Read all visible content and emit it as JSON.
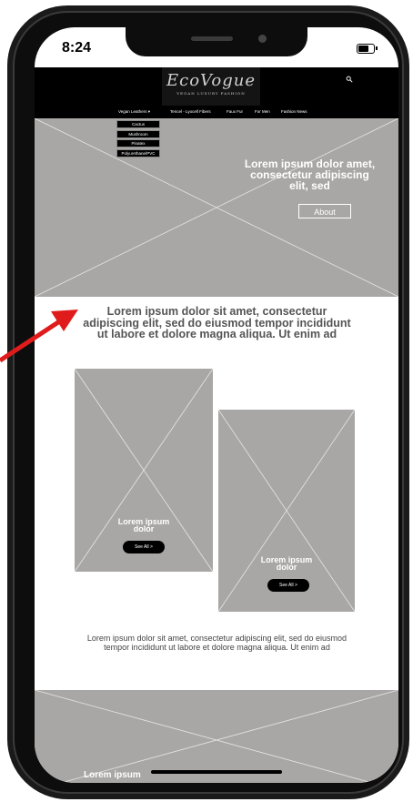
{
  "status_bar": {
    "time": "8:24"
  },
  "header": {
    "logo": "EcoVogue",
    "logo_tagline": "VEGAN LUXURY FASHION",
    "nav": [
      "Vegan Leathers ▾",
      "Tencel - Lyocell Fibers",
      "Faux Fur",
      "For Men",
      "Fashion News"
    ],
    "dropdown": [
      "Cactus",
      "Mushroom",
      "Pinatex",
      "Polyurethane/PVC"
    ]
  },
  "hero": {
    "title": "Lorem ipsum dolor amet, consectetur adipiscing elit, sed",
    "button": "About"
  },
  "section": {
    "heading": "Lorem ipsum dolor sit amet, consectetur adipiscing elit, sed do eiusmod tempor incididunt ut labore et dolore magna aliqua. Ut enim ad",
    "cards": [
      {
        "title": "Lorem ipsum dolor",
        "button": "See All >"
      },
      {
        "title": "Lorem ipsum dolor",
        "button": "See All >"
      }
    ],
    "body": "Lorem ipsum dolor sit amet, consectetur adipiscing elit, sed do eiusmod tempor incididunt ut labore et dolore magna aliqua. Ut enim ad"
  },
  "bottom": {
    "title": "Lorem ipsum"
  },
  "colors": {
    "placeholder": "#a8a7a5",
    "header": "#000000",
    "arrow": "#e01b1b"
  }
}
